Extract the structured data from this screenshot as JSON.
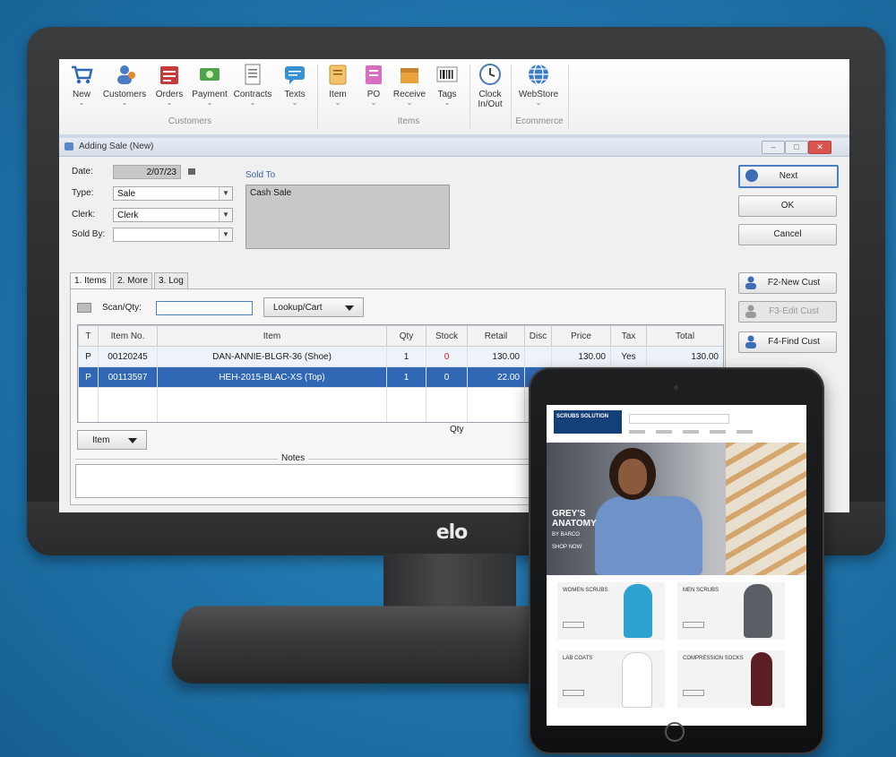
{
  "ribbon": {
    "buttons": [
      {
        "label": "New",
        "icon": "cart-icon"
      },
      {
        "label": "Customers",
        "icon": "customers-icon"
      },
      {
        "label": "Orders",
        "icon": "orders-icon"
      },
      {
        "label": "Payment",
        "icon": "payment-icon"
      },
      {
        "label": "Contracts",
        "icon": "contracts-icon"
      },
      {
        "label": "Texts",
        "icon": "texts-icon"
      },
      {
        "label": "Item",
        "icon": "item-icon"
      },
      {
        "label": "PO",
        "icon": "po-icon"
      },
      {
        "label": "Receive",
        "icon": "receive-icon"
      },
      {
        "label": "Tags",
        "icon": "barcode-icon"
      },
      {
        "label": "Clock In/Out",
        "icon": "clock-icon"
      },
      {
        "label": "WebStore",
        "icon": "globe-icon"
      }
    ],
    "groups": {
      "customers": "Customers",
      "items": "Items",
      "ecommerce": "Ecommerce"
    }
  },
  "dialog": {
    "title": "Adding Sale (New)",
    "date_label": "Date:",
    "date_value": "2/07/23",
    "type_label": "Type:",
    "type_value": "Sale",
    "clerk_label": "Clerk:",
    "clerk_value": "Clerk",
    "soldby_label": "Sold By:",
    "soldby_value": "",
    "soldto_label": "Sold To",
    "soldto_value": "Cash Sale",
    "buttons": {
      "next": "Next",
      "ok": "OK",
      "cancel": "Cancel",
      "new_cust": "F2-New Cust",
      "edit_cust": "F3-Edit Cust",
      "find_cust": "F4-Find Cust"
    },
    "tabs": [
      "1. Items",
      "2. More",
      "3. Log"
    ],
    "scan_label": "Scan/Qty:",
    "lookup_label": "Lookup/Cart",
    "columns": [
      "T",
      "Item No.",
      "Item",
      "Qty",
      "Stock",
      "Retail",
      "Disc",
      "Price",
      "Tax",
      "Total"
    ],
    "rows": [
      [
        "P",
        "00120245",
        "DAN-ANNIE-BLGR-36 (Shoe)",
        "1",
        "0",
        "130.00",
        "",
        "130.00",
        "Yes",
        "130.00"
      ],
      [
        "P",
        "00113597",
        "HEH-2015-BLAC-XS (Top)",
        "1",
        "0",
        "22.00",
        "",
        "",
        "",
        ""
      ]
    ],
    "qty_footer": "Qty",
    "item_button": "Item",
    "notes_label": "Notes"
  },
  "monitor": {
    "brand": "elo"
  },
  "tablet": {
    "logo": "SCRUBS SOLUTION",
    "hero_text": "GREY'S ANATOMY",
    "hero_sub": "BY BARCO",
    "hero_cta": "SHOP NOW",
    "cards": [
      "WOMEN SCRUBS",
      "MEN SCRUBS",
      "LAB COATS",
      "COMPRESSION SOCKS"
    ]
  },
  "colors": {
    "selection": "#3168b5",
    "background": "#1f74ab",
    "stock_red": "#d21e1e"
  }
}
